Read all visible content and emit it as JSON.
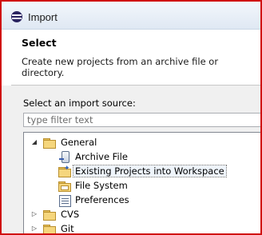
{
  "window": {
    "title": "Import",
    "icon": "eclipse-icon"
  },
  "header": {
    "title": "Select",
    "description": "Create new projects from an archive file or directory."
  },
  "source": {
    "label": "Select an import source:",
    "filter_placeholder": "type filter text"
  },
  "tree": {
    "items": [
      {
        "label": "General",
        "icon": "folder-open-icon",
        "expanded": true
      },
      {
        "label": "Archive File",
        "icon": "archive-file-icon"
      },
      {
        "label": "Existing Projects into Workspace",
        "icon": "project-folder-icon",
        "selected": true
      },
      {
        "label": "File System",
        "icon": "folder-icon"
      },
      {
        "label": "Preferences",
        "icon": "preferences-icon"
      },
      {
        "label": "CVS",
        "icon": "folder-icon",
        "expanded": false
      },
      {
        "label": "Git",
        "icon": "folder-icon",
        "expanded": false
      }
    ]
  },
  "colors": {
    "frame_border": "#d01010",
    "title_bar": "#dfe8f3",
    "selection_bg": "#eef4fb"
  }
}
